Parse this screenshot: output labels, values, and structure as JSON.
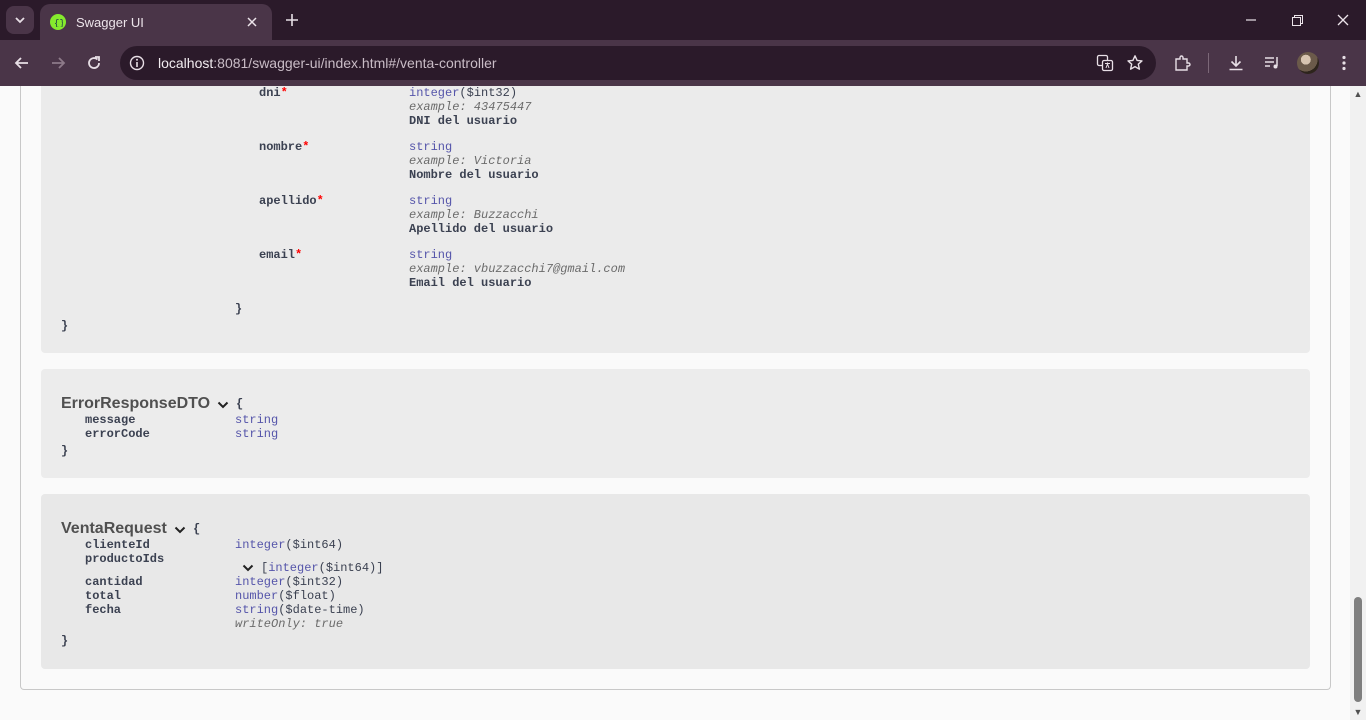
{
  "browser": {
    "tab_title": "Swagger UI",
    "url_host": "localhost",
    "url_rest": ":8081/swagger-ui/index.html#/venta-controller"
  },
  "usuario_props": [
    {
      "name": "dni",
      "type": "integer",
      "format": "($int32)",
      "example": "example: 43475447",
      "description": "DNI del usuario"
    },
    {
      "name": "nombre",
      "type": "string",
      "format": "",
      "example": "example: Victoria",
      "description": "Nombre del usuario"
    },
    {
      "name": "apellido",
      "type": "string",
      "format": "",
      "example": "example: Buzzacchi",
      "description": "Apellido del usuario"
    },
    {
      "name": "email",
      "type": "string",
      "format": "",
      "example": "example: vbuzzacchi7@gmail.com",
      "description": "Email del usuario"
    }
  ],
  "required_mark": "*",
  "inner_close": "}",
  "outer_close": "}",
  "error_model": {
    "title": "ErrorResponseDTO",
    "open": "{",
    "close": "}",
    "props": [
      {
        "name": "message",
        "type": "string"
      },
      {
        "name": "errorCode",
        "type": "string"
      }
    ]
  },
  "venta_model": {
    "title": "VentaRequest",
    "open": "{",
    "close": "}",
    "clienteId": {
      "name": "clienteId",
      "type": "integer",
      "format": "($int64)"
    },
    "productoIds": {
      "name": "productoIds",
      "open": "[",
      "type": "integer",
      "format": "($int64)",
      "close": "]"
    },
    "cantidad": {
      "name": "cantidad",
      "type": "integer",
      "format": "($int32)"
    },
    "total": {
      "name": "total",
      "type": "number",
      "format": "($float)"
    },
    "fecha": {
      "name": "fecha",
      "type": "string",
      "format": "($date-time)",
      "note": "writeOnly: true"
    }
  }
}
